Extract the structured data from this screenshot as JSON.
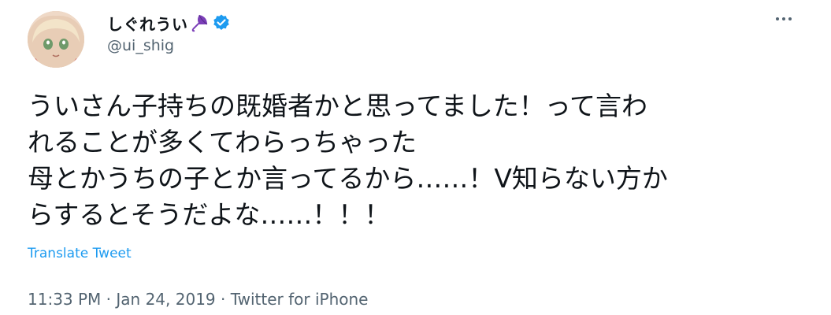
{
  "author": {
    "display_name": "しぐれうい",
    "handle": "@ui_shig",
    "name_emoji": "umbrella-icon",
    "verified": true
  },
  "tweet": {
    "lines": [
      "ういさん子持ちの既婚者かと思ってました！って言わ",
      "れることが多くてわらっちゃった",
      "母とかうちの子とか言ってるから……！V知らない方か",
      "らするとそうだよな……！！！"
    ],
    "translate_label": "Translate Tweet"
  },
  "meta": {
    "time": "11:33 PM",
    "separator": " · ",
    "date": "Jan 24, 2019",
    "source": "Twitter for iPhone"
  },
  "colors": {
    "verified": "#1d9bf0",
    "link": "#1d9bf0",
    "secondary_text": "#536471",
    "umbrella": "#7b3fb8"
  }
}
